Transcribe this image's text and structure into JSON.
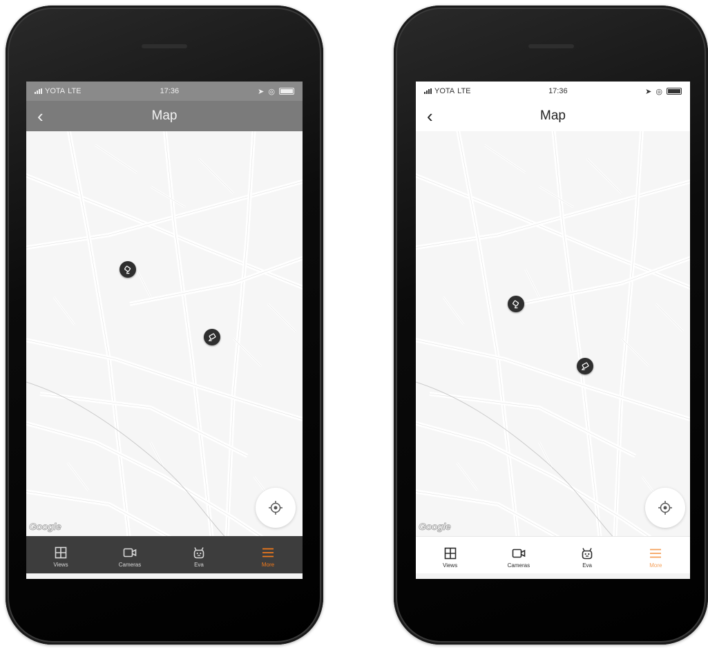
{
  "phones": [
    {
      "theme": "dark",
      "status": {
        "carrier": "YOTA",
        "network": "LTE",
        "time": "17:36"
      },
      "navbar": {
        "back_glyph": "‹",
        "title": "Map"
      },
      "map": {
        "attribution": "Google"
      },
      "tabs": [
        {
          "label": "Views",
          "icon": "grid-icon",
          "active": false
        },
        {
          "label": "Cameras",
          "icon": "video-camera-icon",
          "active": false
        },
        {
          "label": "Eva",
          "icon": "robot-icon",
          "active": false
        },
        {
          "label": "More",
          "icon": "menu-icon",
          "active": true
        }
      ]
    },
    {
      "theme": "light",
      "status": {
        "carrier": "YOTA",
        "network": "LTE",
        "time": "17:36"
      },
      "navbar": {
        "back_glyph": "‹",
        "title": "Map"
      },
      "map": {
        "attribution": "Google"
      },
      "tabs": [
        {
          "label": "Views",
          "icon": "grid-icon",
          "active": false
        },
        {
          "label": "Cameras",
          "icon": "video-camera-icon",
          "active": false
        },
        {
          "label": "Eva",
          "icon": "robot-icon",
          "active": false
        },
        {
          "label": "More",
          "icon": "menu-icon",
          "active": true
        }
      ]
    }
  ],
  "colors": {
    "accent": "#f17a1c",
    "accent_light": "#f5a05a",
    "pin": "#2f2f2f"
  }
}
